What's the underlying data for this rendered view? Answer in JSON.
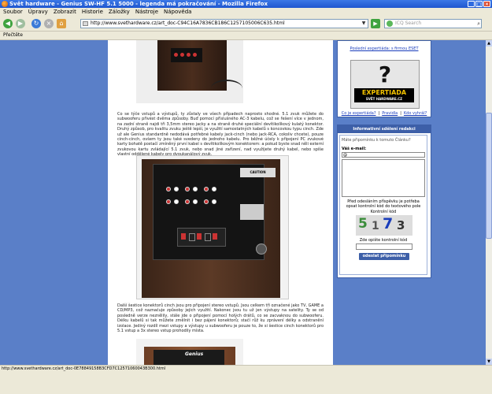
{
  "window": {
    "title": "Svět hardware - Genius SW-HF 5.1 5000 - legenda má pokračování - Mozilla Firefox",
    "buttons": [
      "_",
      "□",
      "×"
    ]
  },
  "menu": [
    "Soubor",
    "Úpravy",
    "Zobrazit",
    "Historie",
    "Záložky",
    "Nástroje",
    "Nápověda"
  ],
  "toolbar": {
    "back": "◀",
    "forward": "▶",
    "reload": "↻",
    "stop": "×",
    "home": "⌂",
    "url": "http://www.svethardware.cz/art_doc-C94C16A7836CB186C1257105006C635.html",
    "search_placeholder": "ICQ Search",
    "go": "▶"
  },
  "bookmarks": {
    "item": "Přečtěte"
  },
  "article": {
    "para1": "Co se týče vstupů a výstupů, ty zůstaly ve všech případech naprosto shodné. 5.1 zvuk můžete do subwooferu přivést dvěma způsoby. Buď pomocí příslušného AC-3 kabelu, což se řešení více v jednom, na zadní straně najdi tři 3,5mm stereo jacky a na straně druhé speciální devítikolíkový kulatý konektor. Druhý způsob, pro kvalitu zvuku ještě lepší, je využití samostatných kabelů s koncovkou typu cinch. Zde už ale Genius standardně nedodává potřebné kabely jack-cinch (nebo jack-RCA, cokoliv chcete), pouze cinch-cinch, ovšem ty jsou také svedeny do jednoho kabelu. Pro běžné účely k připojení PC zvukové karty bohatě postačí zmíněný první kabel s devítikolíkovým konektorem: a pokud byste snad něli externí zvukovou kartu zvládající 5.1 zvuk, nebo snad jiné zařízení, nad využijete druhý kabel, nebo spíše vlastní oddělené kabely pro dvoukanálový zvuk.",
    "para2": "Další šestice konektorů cinch jsou pro připojení stereo vstupů. Jsou celkem tři označené jako TV, GAME a CD/MP3, což naznačuje způsoby jejich využití. Nakonec jsou tu už jen výstupy na satelity. Ty se od posledně verze neznělily, stále jde o připojení pomocí holých drátů, co se zacvaknou do subwooferu. Délku kabelů si tak můžete změlnit i bez pájení konektorů; stačí růž ku zprávení délky a odstranění izolace. Jediný rozdíl mezi vstupy a výstupy u subwooferu je pouze to, že si šestice cinch konektorů pro 5.1 vstup a 3x stereo vstup prohodily místa."
  },
  "sidebar": {
    "poll_link": "Poslední expertiáda: s firmou ESET",
    "expertiada_title": "EXPERTIADA",
    "expertiada_sub": "SVĚT HARDWARE.CZ",
    "links": [
      "Co je expertiáda?",
      "Pravidla",
      "Kdo vyhrál?"
    ],
    "link_sep": "|"
  },
  "comment": {
    "header": "Informativní sdělení redakci",
    "prompt": "Máte připomínku k tomuto Článku?",
    "email_label": "Váš e-mail:",
    "email_value": "@",
    "note": "Před odesláním příspěvku je potřeba opsat kontrolní kód do textového pole",
    "code_label": "Kontrolní kód",
    "captcha_chars": [
      "5",
      "1",
      "7",
      "3"
    ],
    "repeat_label": "Zde opište kontrolní kód",
    "submit": "odeslat připomínku"
  },
  "photos": {
    "front_brand": "Genius",
    "warning_label": "CAUTION"
  },
  "status": {
    "text": "http://www.svethardware.cz/art_doc-0E78849158B3CFD7C12571060043B300.html"
  }
}
